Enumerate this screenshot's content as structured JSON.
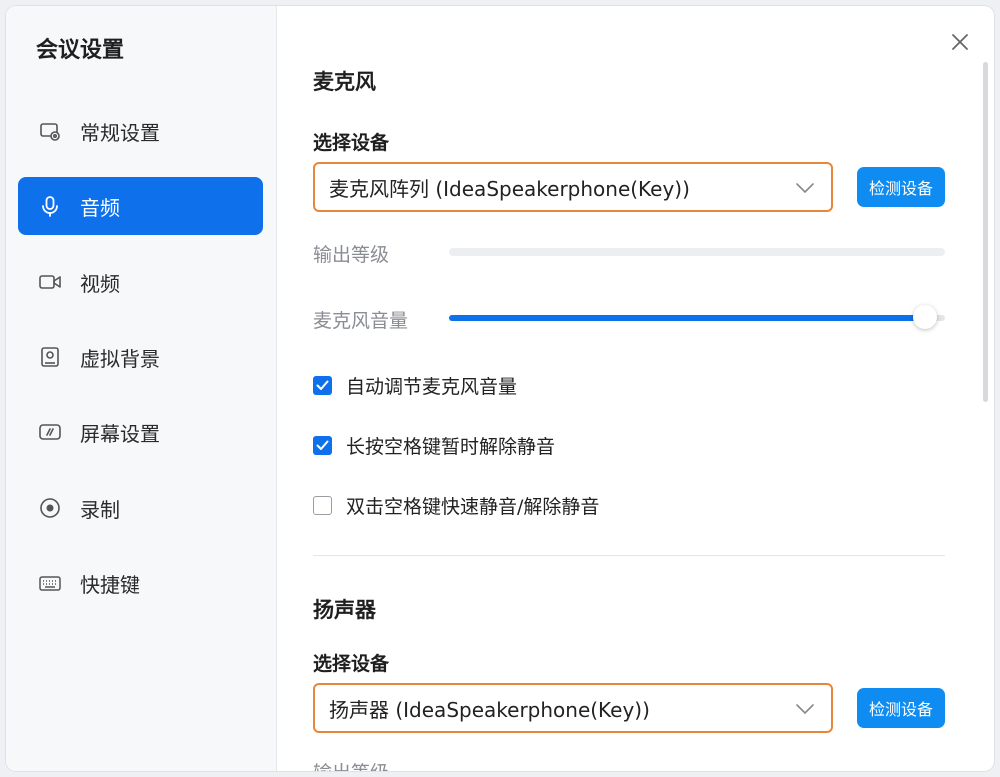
{
  "sidebar": {
    "title": "会议设置",
    "items": [
      {
        "label": "常规设置",
        "icon": "monitor-settings-icon"
      },
      {
        "label": "音频",
        "icon": "microphone-icon",
        "active": true
      },
      {
        "label": "视频",
        "icon": "video-camera-icon"
      },
      {
        "label": "虚拟背景",
        "icon": "portrait-icon"
      },
      {
        "label": "屏幕设置",
        "icon": "screen-share-icon"
      },
      {
        "label": "录制",
        "icon": "record-icon"
      },
      {
        "label": "快捷键",
        "icon": "keyboard-icon"
      }
    ]
  },
  "microphone": {
    "title": "麦克风",
    "select_label": "选择设备",
    "device": "麦克风阵列 (IdeaSpeakerphone(Key))",
    "detect_button": "检测设备",
    "output_level_label": "输出等级",
    "output_level": 0,
    "volume_label": "麦克风音量",
    "volume": 0.96,
    "options": [
      {
        "label": "自动调节麦克风音量",
        "checked": true
      },
      {
        "label": "长按空格键暂时解除静音",
        "checked": true
      },
      {
        "label": "双击空格键快速静音/解除静音",
        "checked": false
      }
    ]
  },
  "speaker": {
    "title": "扬声器",
    "select_label": "选择设备",
    "device": "扬声器 (IdeaSpeakerphone(Key))",
    "detect_button": "检测设备",
    "output_level_label": "输出等级"
  },
  "colors": {
    "accent": "#0e71eb",
    "highlight_border": "#e8863a",
    "button": "#0e8cf1"
  }
}
